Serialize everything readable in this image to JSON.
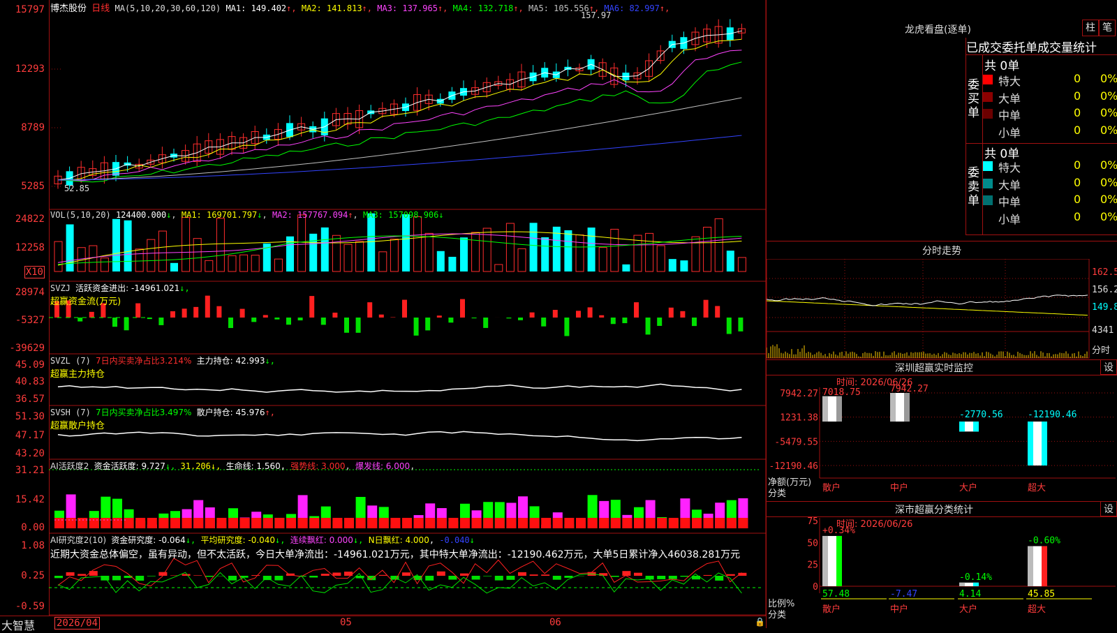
{
  "stock": {
    "name": "博杰股份",
    "period": "日线"
  },
  "main_ma": {
    "label": "MA(5,10,20,30,60,120)",
    "items": [
      {
        "text": "MA1: 149.402",
        "arrow": "↑",
        "color": "#ffffff"
      },
      {
        "text": "MA2: 141.813",
        "arrow": "↑",
        "color": "#ffff00"
      },
      {
        "text": "MA3: 137.965",
        "arrow": "↑",
        "color": "#ff44ff"
      },
      {
        "text": "MA4: 132.718",
        "arrow": "↑",
        "color": "#00ff00"
      },
      {
        "text": "MA5: 105.556",
        "arrow": "↑",
        "color": "#c0c0c0"
      },
      {
        "text": "MA6: 82.997",
        "arrow": "↑",
        "color": "#3344ff"
      }
    ],
    "high_mark": "157.97",
    "low_mark": "52.85",
    "y_labels": [
      "15797",
      "12293",
      "8789",
      "5285"
    ]
  },
  "vol": {
    "label": "VOL(5,10,20)",
    "value": "124400.000",
    "ma1": "MA1: 169701.797",
    "ma2": "MA2: 157767.094",
    "ma3": "MA3: 157098.906",
    "arrows": [
      "↓",
      "↓",
      "↑",
      "↓"
    ],
    "y_labels": [
      "24822",
      "12258"
    ],
    "unit": "X10"
  },
  "svzj": {
    "label": "SVZJ",
    "text": "活跃资金进出: -14961.021",
    "arrow": "↓,",
    "subtitle": "超赢资金流(万元)",
    "y_labels": [
      "28974",
      "-5327",
      "-39629"
    ]
  },
  "svzl": {
    "label": "SVZL (7)",
    "text1": "7日内买卖净占比3.214%",
    "text2": "主力持仓: 42.993",
    "arrow": "↓,",
    "subtitle": "超赢主力持仓",
    "y_labels": [
      "45.09",
      "40.83",
      "36.57"
    ]
  },
  "svsh": {
    "label": "SVSH (7)",
    "text1": "7日内买卖净占比3.497%",
    "text2": "散户持仓: 45.976",
    "arrow": "↑,",
    "subtitle": "超赢散户持仓",
    "y_labels": [
      "51.30",
      "47.17",
      "43.20"
    ]
  },
  "ai_active": {
    "label": "AI活跃度2",
    "text1": "资金活跃度: 9.727",
    "text2": "31.206",
    "text3": "生命线: 1.560",
    "text4": "强势线: 3.000",
    "text5": "爆发线: 6.000",
    "arrows": [
      "↓,",
      "↓,",
      ","
    ],
    "y_labels": [
      "31.21",
      "15.42",
      "0.00"
    ]
  },
  "ai_research": {
    "label": "AI研究度2(10)",
    "text1": "资金研究度: -0.064",
    "text2": "平均研究度: -0.040",
    "text3": "连续飘红: 0.000",
    "text4": "N日飘红: 4.000",
    "text5": "-0.040",
    "arrows": [
      "↓,",
      "↓,",
      "↓,",
      ",",
      "↓"
    ],
    "summary": "近期大资金总体偏空，虽有异动，但不太活跃，今日大单净流出：-14961.021万元，其中特大单净流出：-12190.462万元，大单5日累计净入46038.281万元",
    "y_labels": [
      "1.08",
      "0.25",
      "-0.59"
    ]
  },
  "xaxis": {
    "brand": "大智慧",
    "dates": [
      "2026/04",
      "05",
      "06"
    ]
  },
  "dragon": {
    "title": "龙虎看盘(逐单)",
    "btn_bar": "柱",
    "btn_pen": "笔",
    "header": "已成交委托单成交量统计",
    "buy": {
      "side": "委买单",
      "total": "共 0单",
      "rows": [
        {
          "label": "特大",
          "value": "0",
          "pct": "0%",
          "color": "#ff0000"
        },
        {
          "label": "大单",
          "value": "0",
          "pct": "0%",
          "color": "#8b0000"
        },
        {
          "label": "中单",
          "value": "0",
          "pct": "0%",
          "color": "#6b0000"
        },
        {
          "label": "小单",
          "value": "0",
          "pct": "0%",
          "color": ""
        }
      ]
    },
    "sell": {
      "side": "委卖单",
      "total": "共 0单",
      "rows": [
        {
          "label": "特大",
          "value": "0",
          "pct": "0%",
          "color": "#00ffff"
        },
        {
          "label": "大单",
          "value": "0",
          "pct": "0%",
          "color": "#008b8b"
        },
        {
          "label": "中单",
          "value": "0",
          "pct": "0%",
          "color": "#007070"
        },
        {
          "label": "小单",
          "value": "0",
          "pct": "0%",
          "color": ""
        }
      ]
    }
  },
  "intraday": {
    "title": "分时走势",
    "y_labels": [
      "162.5",
      "156.2",
      "149.8",
      "4341"
    ],
    "unit": "分时"
  },
  "sz_monitor": {
    "title": "深圳超赢实时监控",
    "btn": "设",
    "time": "时间: 2026/06/26",
    "y_labels": [
      "7942.27",
      "1231.38",
      "-5479.55",
      "-12190.46"
    ],
    "axis_title": "净额(万元)",
    "axis_sub": "分类",
    "cats": [
      "散户",
      "中户",
      "大户",
      "超大"
    ],
    "values": [
      7018.75,
      7942.27,
      -2770.56,
      -12190.46
    ],
    "value_labels": [
      "7018.75",
      "7942.27",
      "-2770.56",
      "-12190.46"
    ]
  },
  "sz_class": {
    "title": "深市超赢分类统计",
    "btn": "设",
    "time": "时间: 2026/06/26",
    "y_labels": [
      "75",
      "50",
      "25",
      "0"
    ],
    "axis_title": "比例%",
    "axis_sub": "分类",
    "cats": [
      "散户",
      "中户",
      "大户",
      "超大"
    ],
    "values": [
      57.48,
      -7.47,
      4.14,
      45.85
    ],
    "changes": [
      "+0.34%",
      "",
      "-0.14%",
      "-0.60%"
    ]
  },
  "chart_data": {
    "type": "bar",
    "title": "深圳超赢实时监控",
    "categories": [
      "散户",
      "中户",
      "大户",
      "超大"
    ],
    "series": [
      {
        "name": "净额(万元)",
        "values": [
          7018.75,
          7942.27,
          -2770.56,
          -12190.46
        ]
      }
    ]
  }
}
